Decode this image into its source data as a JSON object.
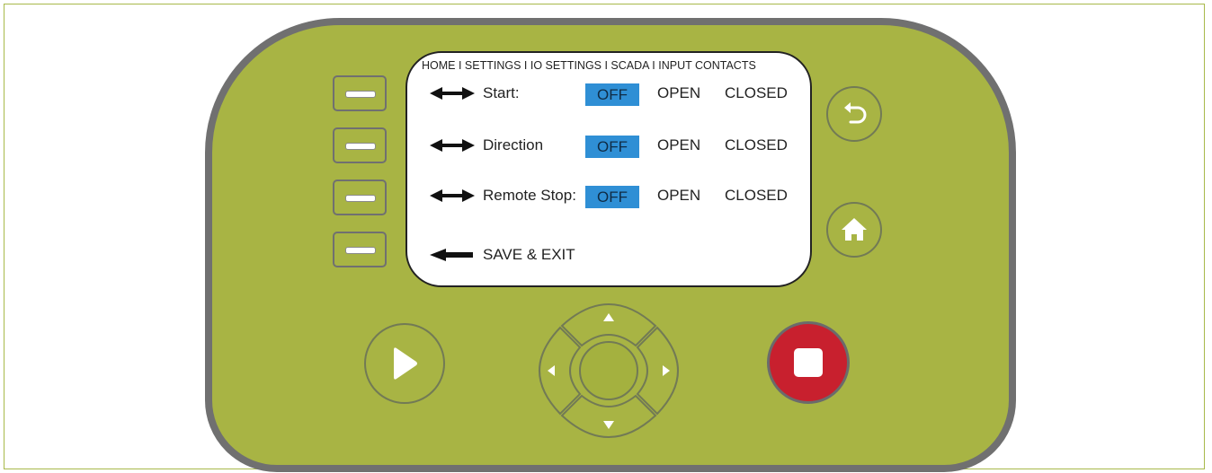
{
  "screen": {
    "breadcrumb": "HOME I SETTINGS I IO SETTINGS I SCADA I INPUT CONTACTS",
    "rows": [
      {
        "label": "Start:",
        "options": [
          "OFF",
          "OPEN",
          "CLOSED"
        ],
        "selected": "OFF"
      },
      {
        "label": "Direction",
        "options": [
          "OFF",
          "OPEN",
          "CLOSED"
        ],
        "selected": "OFF"
      },
      {
        "label": "Remote Stop:",
        "options": [
          "OFF",
          "OPEN",
          "CLOSED"
        ],
        "selected": "OFF"
      }
    ],
    "save_exit": "SAVE & EXIT"
  },
  "icons": {
    "row_arrow": "left-right-arrow-icon",
    "save_arrow": "left-arrow-icon",
    "soft_key": "dash-icon",
    "back": "undo-arrow-icon",
    "home": "home-icon",
    "play": "play-icon",
    "stop": "stop-icon",
    "dpad": [
      "up-arrow-icon",
      "down-arrow-icon",
      "left-arrow-icon",
      "right-arrow-icon"
    ]
  },
  "colors": {
    "device_body": "#a8b444",
    "device_border": "#707070",
    "selected_option": "#2f8fd5",
    "stop_button": "#c8202e"
  }
}
